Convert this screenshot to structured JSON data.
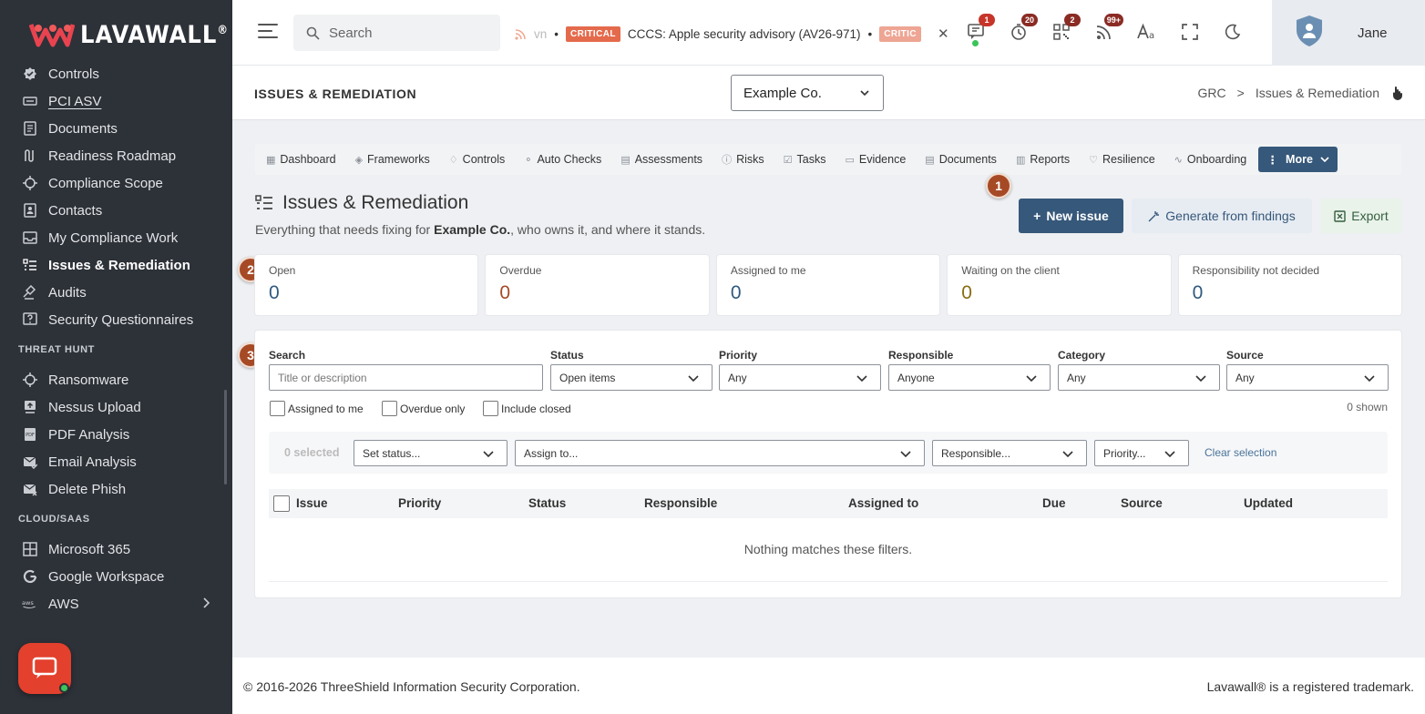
{
  "brand": {
    "name_part1": "LAVA",
    "name_part2": "WALL",
    "reg": "®"
  },
  "sidebar": {
    "items_a": [
      {
        "label": "Controls",
        "icon": "badge-check-icon"
      },
      {
        "label": "PCI ASV",
        "icon": "asv-icon"
      },
      {
        "label": "Documents",
        "icon": "document-icon"
      },
      {
        "label": "Readiness Roadmap",
        "icon": "roadmap-icon"
      },
      {
        "label": "Compliance Scope",
        "icon": "crosshair-icon"
      },
      {
        "label": "Contacts",
        "icon": "contacts-icon"
      },
      {
        "label": "My Compliance Work",
        "icon": "inbox-icon"
      },
      {
        "label": "Issues & Remediation",
        "icon": "list-icon"
      },
      {
        "label": "Audits",
        "icon": "gavel-icon"
      },
      {
        "label": "Security Questionnaires",
        "icon": "question-icon"
      }
    ],
    "section_threat": "THREAT HUNT",
    "items_b": [
      {
        "label": "Ransomware",
        "icon": "crosshair-icon"
      },
      {
        "label": "Nessus Upload",
        "icon": "upload-icon"
      },
      {
        "label": "PDF Analysis",
        "icon": "pdf-icon"
      },
      {
        "label": "Email Analysis",
        "icon": "email-check-icon"
      },
      {
        "label": "Delete Phish",
        "icon": "email-delete-icon"
      }
    ],
    "section_cloud": "CLOUD/SAAS",
    "items_c": [
      {
        "label": "Microsoft 365",
        "icon": "windows-icon"
      },
      {
        "label": "Google Workspace",
        "icon": "google-icon"
      },
      {
        "label": "AWS",
        "icon": "aws-icon"
      }
    ]
  },
  "topbar": {
    "search_placeholder": "Search",
    "ticker_fade": "vn",
    "ticker_badge": "CRITICAL",
    "ticker_text": "CCCS: Apple security advisory (AV26-971)",
    "ticker_badge2": "CRITIC",
    "counts": {
      "messages": "1",
      "timer": "20",
      "qr": "2",
      "feeds": "99+"
    },
    "user_name": "Jane"
  },
  "pagehead": {
    "title": "ISSUES & REMEDIATION",
    "company": "Example Co.",
    "crumb_root": "GRC",
    "crumb_sep": ">",
    "crumb_current": "Issues & Remediation"
  },
  "tabs": [
    "Dashboard",
    "Frameworks",
    "Controls",
    "Auto Checks",
    "Assessments",
    "Risks",
    "Tasks",
    "Evidence",
    "Documents",
    "Reports",
    "Resilience",
    "Onboarding"
  ],
  "more_label": "More",
  "heading": "Issues & Remediation",
  "sub": {
    "pre": "Everything that needs fixing for ",
    "company": "Example Co.",
    "post": ", who owns it, and where it stands."
  },
  "markers": [
    "1",
    "2",
    "3"
  ],
  "actions": {
    "new": "New issue",
    "generate": "Generate from findings",
    "export": "Export"
  },
  "stats": [
    {
      "label": "Open",
      "value": "0",
      "color": "#2f5a80"
    },
    {
      "label": "Overdue",
      "value": "0",
      "color": "#a64a26"
    },
    {
      "label": "Assigned to me",
      "value": "0",
      "color": "#2f5a80"
    },
    {
      "label": "Waiting on the client",
      "value": "0",
      "color": "#8a6d12"
    },
    {
      "label": "Responsibility not decided",
      "value": "0",
      "color": "#2f5a80"
    }
  ],
  "filters": {
    "search_label": "Search",
    "search_placeholder": "Title or description",
    "status_label": "Status",
    "status_value": "Open items",
    "priority_label": "Priority",
    "priority_value": "Any",
    "responsible_label": "Responsible",
    "responsible_value": "Anyone",
    "category_label": "Category",
    "category_value": "Any",
    "source_label": "Source",
    "source_value": "Any",
    "chk_assigned": "Assigned to me",
    "chk_overdue": "Overdue only",
    "chk_closed": "Include closed",
    "shown": "0 shown"
  },
  "bulk": {
    "selected": "0 selected",
    "set_status": "Set status...",
    "assign": "Assign to...",
    "responsible": "Responsible...",
    "priority": "Priority...",
    "clear": "Clear selection"
  },
  "table": {
    "headers": [
      "Issue",
      "Priority",
      "Status",
      "Responsible",
      "Assigned to",
      "Due",
      "Source",
      "Updated"
    ],
    "empty": "Nothing matches these filters."
  },
  "footer": {
    "copyright": "© 2016-2026 ThreeShield Information Security Corporation.",
    "trademark": "Lavawall® is a registered trademark."
  }
}
